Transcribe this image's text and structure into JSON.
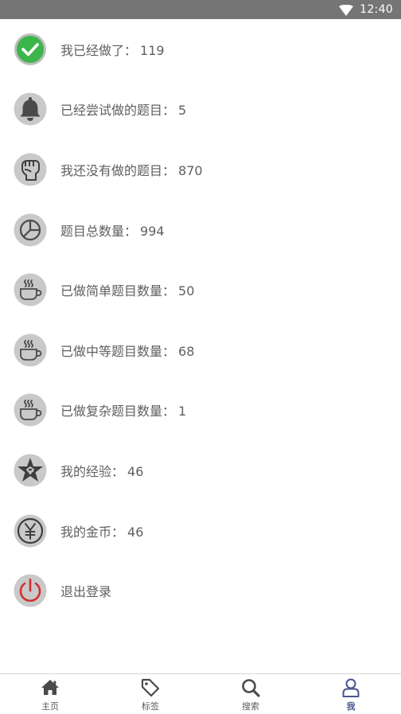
{
  "status_bar": {
    "time": "12:40",
    "wifi_icon": "wifi-icon"
  },
  "stats": [
    {
      "label": "我已经做了：",
      "value": "119",
      "icon": "check-icon",
      "color": "#3cb54a"
    },
    {
      "label": "已经尝试做的题目：",
      "value": "5",
      "icon": "bell-icon",
      "color": "#c9c9c9"
    },
    {
      "label": "我还没有做的题目：",
      "value": "870",
      "icon": "fist-icon",
      "color": "#c9c9c9"
    },
    {
      "label": "题目总数量：",
      "value": "994",
      "icon": "pie-chart-icon",
      "color": "#c9c9c9"
    },
    {
      "label": "已做简单题目数量：",
      "value": "50",
      "icon": "coffee-cup-icon",
      "color": "#c9c9c9"
    },
    {
      "label": "已做中等题目数量：",
      "value": "68",
      "icon": "coffee-cup-icon",
      "color": "#c9c9c9"
    },
    {
      "label": "已做复杂题目数量：",
      "value": "1",
      "icon": "coffee-cup-icon",
      "color": "#c9c9c9"
    },
    {
      "label": "我的经验：",
      "value": "46",
      "icon": "star-badge-icon",
      "color": "#c9c9c9"
    },
    {
      "label": "我的金币：",
      "value": "46",
      "icon": "yen-coin-icon",
      "color": "#c9c9c9"
    },
    {
      "label": "退出登录",
      "value": "",
      "icon": "power-icon",
      "color": "#d32f2f"
    }
  ],
  "tabbar": {
    "active_color": "#4a5590",
    "tabs": [
      {
        "label": "主页",
        "icon": "home-icon"
      },
      {
        "label": "标签",
        "icon": "tag-icon"
      },
      {
        "label": "搜索",
        "icon": "search-icon"
      },
      {
        "label": "我",
        "icon": "user-icon"
      }
    ]
  }
}
